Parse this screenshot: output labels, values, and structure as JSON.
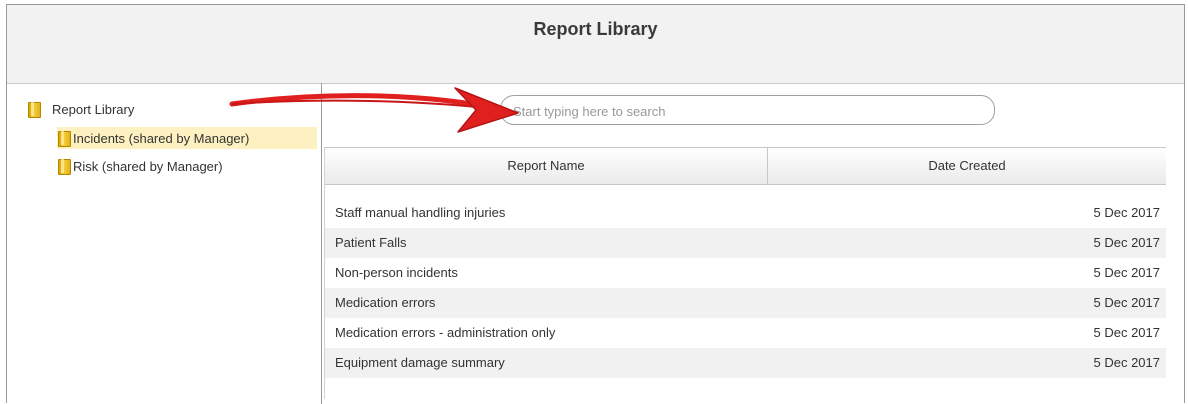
{
  "header": {
    "title": "Report Library"
  },
  "tree": {
    "root": {
      "label": "Report Library",
      "icon": "folder-icon"
    },
    "children": [
      {
        "label": "Incidents (shared by Manager)",
        "icon": "folder-icon",
        "selected": true
      },
      {
        "label": "Risk (shared by Manager)",
        "icon": "folder-icon",
        "selected": false
      }
    ]
  },
  "search": {
    "placeholder": "Start typing here to search",
    "value": ""
  },
  "table": {
    "columns": [
      "Report Name",
      "Date Created"
    ],
    "rows": [
      {
        "name": "Staff manual handling injuries",
        "date": "5 Dec 2017"
      },
      {
        "name": "Patient Falls",
        "date": "5 Dec 2017"
      },
      {
        "name": "Non-person incidents",
        "date": "5 Dec 2017"
      },
      {
        "name": "Medication errors",
        "date": "5 Dec 2017"
      },
      {
        "name": "Medication errors - administration only",
        "date": "5 Dec 2017"
      },
      {
        "name": "Equipment damage summary",
        "date": "5 Dec 2017"
      }
    ]
  },
  "colors": {
    "selected_background": "#fdf1c1",
    "header_background": "#f2f2f2",
    "annotation_arrow": "#e0201f"
  }
}
